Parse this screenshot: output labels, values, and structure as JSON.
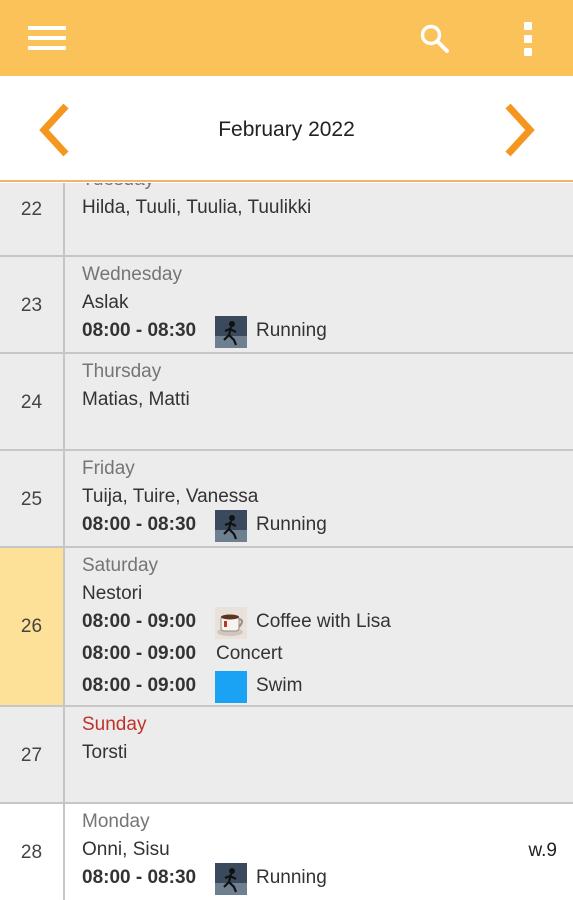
{
  "appbar": {
    "menu_icon": "hamburger-menu-icon",
    "search_icon": "search-icon",
    "more_icon": "more-vert-icon",
    "color": "#fbc25a"
  },
  "month": {
    "title": "February 2022",
    "prev_icon": "chevron-left-icon",
    "next_icon": "chevron-right-icon",
    "arrow_color": "#f5961e"
  },
  "days": [
    {
      "date": "22",
      "weekday": "Tuesday",
      "names": "Hilda, Tuuli, Tuulia, Tuulikki",
      "events": []
    },
    {
      "date": "23",
      "weekday": "Wednesday",
      "names": "Aslak",
      "events": [
        {
          "time": "08:00 - 08:30",
          "icon": "running-photo-icon",
          "title": "Running"
        }
      ]
    },
    {
      "date": "24",
      "weekday": "Thursday",
      "names": "Matias, Matti",
      "events": []
    },
    {
      "date": "25",
      "weekday": "Friday",
      "names": "Tuija, Tuire, Vanessa",
      "events": [
        {
          "time": "08:00 - 08:30",
          "icon": "running-photo-icon",
          "title": "Running"
        }
      ]
    },
    {
      "date": "26",
      "weekday": "Saturday",
      "names": "Nestori",
      "selected": true,
      "events": [
        {
          "time": "08:00 - 09:00",
          "icon": "coffee-cup-icon",
          "title": "Coffee with Lisa"
        },
        {
          "time": "08:00 - 09:00",
          "icon": "",
          "title": "Concert"
        },
        {
          "time": "08:00 - 09:00",
          "icon": "blue-square-icon",
          "title": "Swim"
        }
      ]
    },
    {
      "date": "27",
      "weekday": "Sunday",
      "names": "Torsti",
      "events": []
    },
    {
      "date": "28",
      "weekday": "Monday",
      "names": "Onni, Sisu",
      "week": "w.9",
      "events": [
        {
          "time": "08:00 - 08:30",
          "icon": "running-photo-icon",
          "title": "Running"
        }
      ]
    }
  ]
}
